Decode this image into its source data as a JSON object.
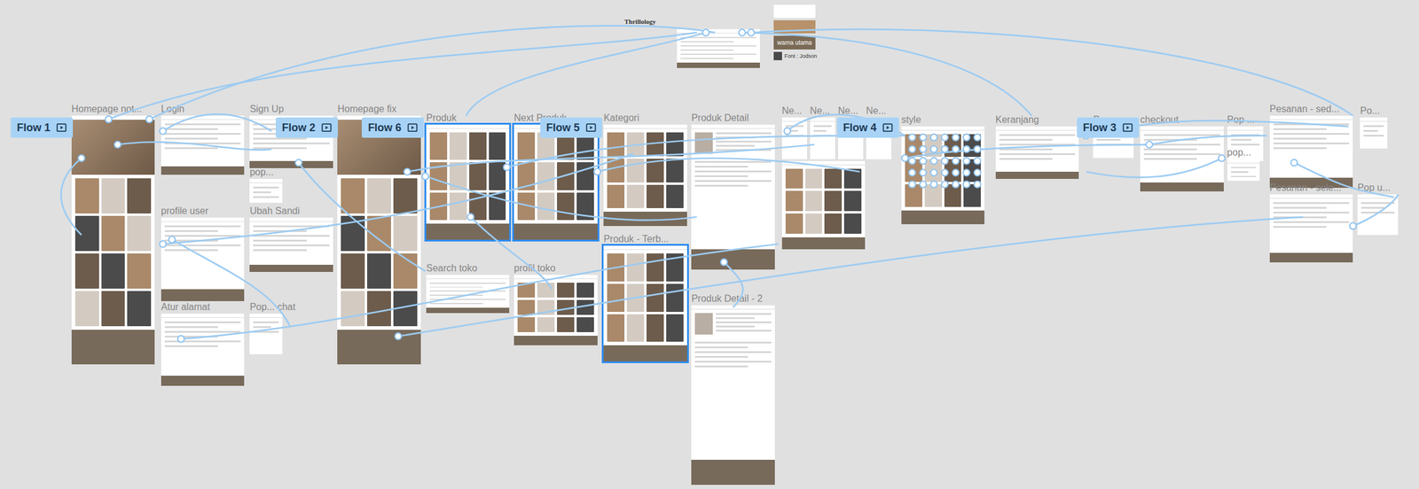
{
  "brand": "Thrillology",
  "swatches": [
    {
      "label": "",
      "color": "#ffffff"
    },
    {
      "label": "",
      "color": "#b8926a"
    },
    {
      "label": "warna utama",
      "color": "#7a6a56"
    },
    {
      "label": "Font : Jodson",
      "color": "#4a4a4a"
    }
  ],
  "flows": [
    {
      "label": "Flow 1"
    },
    {
      "label": "Flow 2"
    },
    {
      "label": "Flow 6"
    },
    {
      "label": "Flow 5"
    },
    {
      "label": "Flow 4"
    },
    {
      "label": "Flow 3"
    }
  ],
  "frames": [
    {
      "label": "Homepage not...",
      "kind": "hero",
      "selected": false
    },
    {
      "label": "Login",
      "kind": "form",
      "selected": false
    },
    {
      "label": "Sign Up",
      "kind": "form",
      "selected": false
    },
    {
      "label": "pop...",
      "kind": "popup",
      "selected": false
    },
    {
      "label": "Homepage fix",
      "kind": "hero",
      "selected": false
    },
    {
      "label": "Produk",
      "kind": "grid",
      "selected": true
    },
    {
      "label": "Next Produk",
      "kind": "grid",
      "selected": true
    },
    {
      "label": "Kategori",
      "kind": "grid",
      "selected": false
    },
    {
      "label": "Produk Detail",
      "kind": "detail",
      "selected": false
    },
    {
      "label": "Ne...",
      "kind": "popup",
      "selected": false
    },
    {
      "label": "Ne...",
      "kind": "popup",
      "selected": false
    },
    {
      "label": "Ne...",
      "kind": "popup",
      "selected": false
    },
    {
      "label": "Ne...",
      "kind": "popup",
      "selected": false
    },
    {
      "label": "",
      "kind": "grid",
      "selected": false
    },
    {
      "label": "style",
      "kind": "grid",
      "selected": false
    },
    {
      "label": "Keranjang",
      "kind": "list",
      "selected": false
    },
    {
      "label": "Pop u...",
      "kind": "popup",
      "selected": false
    },
    {
      "label": "checkout",
      "kind": "list",
      "selected": false
    },
    {
      "label": "Pop ...",
      "kind": "popup",
      "selected": false
    },
    {
      "label": "pop...",
      "kind": "popup",
      "selected": false
    },
    {
      "label": "Pesanan - sed...",
      "kind": "list",
      "selected": false
    },
    {
      "label": "Po...",
      "kind": "popup",
      "selected": false
    },
    {
      "label": "profile user",
      "kind": "list",
      "selected": false
    },
    {
      "label": "Ubah Sandi",
      "kind": "list",
      "selected": false
    },
    {
      "label": "Produk - Terb...",
      "kind": "grid",
      "selected": true
    },
    {
      "label": "Search toko",
      "kind": "list",
      "selected": false
    },
    {
      "label": "profil toko",
      "kind": "grid",
      "selected": false
    },
    {
      "label": "Atur alamat",
      "kind": "list",
      "selected": false
    },
    {
      "label": "Pop... chat",
      "kind": "popup",
      "selected": false
    },
    {
      "label": "Produk Detail - 2",
      "kind": "detail",
      "selected": false
    },
    {
      "label": "Pesanan - sele...",
      "kind": "list",
      "selected": false
    },
    {
      "label": "Pop u...",
      "kind": "popup",
      "selected": false
    },
    {
      "label": "",
      "kind": "list",
      "selected": false
    }
  ]
}
